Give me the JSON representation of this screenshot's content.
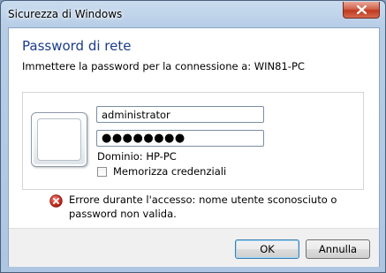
{
  "window": {
    "title": "Sicurezza di Windows"
  },
  "dialog": {
    "heading": "Password di rete",
    "subtitle": "Immettere la password per la connessione a: WIN81-PC"
  },
  "credentials": {
    "username_value": "administrator",
    "password_masked": "●●●●●●●●",
    "domain_text": "Dominio: HP-PC",
    "remember_label": "Memorizza credenziali",
    "remember_checked": false
  },
  "error": {
    "message": "Errore durante l'accesso: nome utente sconosciuto o password non valida."
  },
  "buttons": {
    "ok_label": "OK",
    "cancel_label": "Annulla"
  },
  "icons": {
    "close": "close-icon",
    "user_tile": "user-tile-icon",
    "error": "error-icon"
  },
  "colors": {
    "heading": "#1b3c8a",
    "error_red": "#c8281e",
    "close_red": "#c0381f"
  }
}
